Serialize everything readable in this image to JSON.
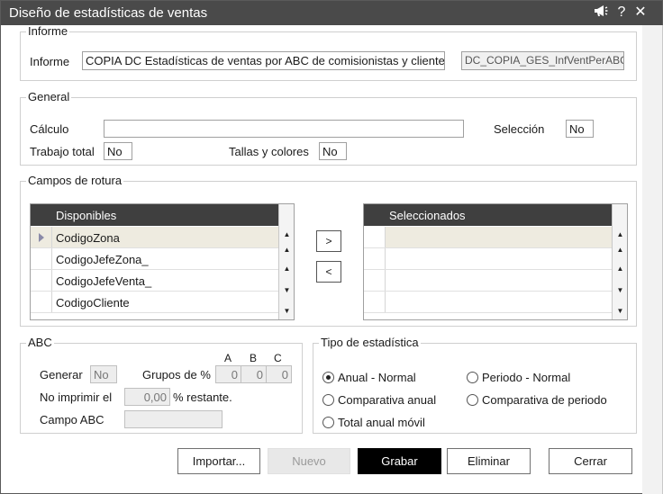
{
  "window": {
    "title": "Diseño de estadísticas de ventas",
    "controls": {
      "announce_icon": "megaphone-icon",
      "help_label": "?",
      "close_label": "✕"
    }
  },
  "informe": {
    "legend": "Informe",
    "label": "Informe",
    "name_value": "COPIA DC Estadísticas de ventas por ABC de comisionistas y clientes",
    "code_value": "DC_COPIA_GES_InfVentPerABC"
  },
  "general": {
    "legend": "General",
    "calculo_label": "Cálculo",
    "calculo_value": "",
    "seleccion_label": "Selección",
    "seleccion_value": "No",
    "trabajo_label": "Trabajo total",
    "trabajo_value": "No",
    "tallas_label": "Tallas y colores",
    "tallas_value": "No"
  },
  "campos": {
    "legend": "Campos de rotura",
    "disponibles_header": "Disponibles",
    "disponibles": [
      "CodigoZona",
      "CodigoJefeZona_",
      "CodigoJefeVenta_",
      "CodigoCliente"
    ],
    "seleccionados_header": "Seleccionados",
    "add_label": ">",
    "remove_label": "<"
  },
  "abc": {
    "legend": "ABC",
    "generar_label": "Generar",
    "generar_value": "No",
    "grupos_label": "Grupos de %",
    "grupos_headers": [
      "A",
      "B",
      "C"
    ],
    "grupos_values": [
      "0",
      "0",
      "0"
    ],
    "no_imprimir_label": "No imprimir el",
    "no_imprimir_value": "0,00",
    "restante_label": "% restante.",
    "campo_label": "Campo ABC",
    "campo_value": ""
  },
  "tipo": {
    "legend": "Tipo de estadística",
    "options": [
      "Anual - Normal",
      "Periodo - Normal",
      "Comparativa anual",
      "Comparativa de periodo",
      "Total anual móvil"
    ],
    "selected": "Anual - Normal"
  },
  "buttons": {
    "importar": "Importar...",
    "nuevo": "Nuevo",
    "grabar": "Grabar",
    "eliminar": "Eliminar",
    "cerrar": "Cerrar"
  }
}
